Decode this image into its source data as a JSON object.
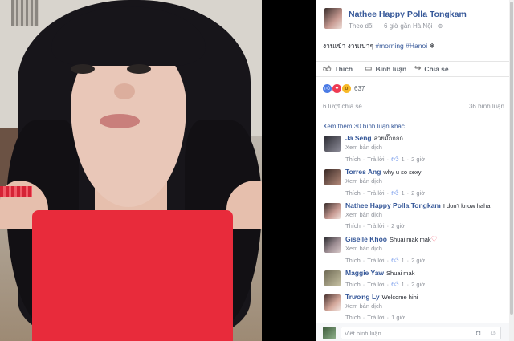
{
  "post": {
    "author": "Nathee Happy Polla Tongkam",
    "follow_label": "Theo dõi",
    "time_location": "6 giờ gần Hà Nội",
    "caption_plain": "งานเข้า งานเบาๆ",
    "hashtag_morning": "#morning",
    "hashtag_hanoi": "#Hanoi",
    "caption_emoji": "❄"
  },
  "actions": {
    "like": "Thích",
    "comment": "Bình luận",
    "share": "Chia sẻ"
  },
  "reactions": {
    "count": "637",
    "colors": {
      "like": "#4b7be5",
      "love": "#ee3b53",
      "wow": "#f7b928"
    }
  },
  "stats": {
    "shares": "6 lượt chia sẻ",
    "comments": "36 bình luận"
  },
  "more_comments": "Xem thêm 30 bình luận khác",
  "labels": {
    "translate": "Xem bản dịch",
    "reply": "Trả lời"
  },
  "comments": [
    {
      "author": "Ja Seng",
      "text": "สวยมั๊กกกก",
      "likes": "1",
      "time": "2 giờ"
    },
    {
      "author": "Torres Ang",
      "text": "why u so sexy",
      "likes": "1",
      "time": "2 giờ"
    },
    {
      "author": "Nathee Happy Polla Tongkam",
      "text": "I don't know haha",
      "likes": "",
      "time": "2 giờ"
    },
    {
      "author": "Giselle Khoo",
      "text": "Shuai mak mak",
      "likes": "1",
      "time": "2 giờ"
    },
    {
      "author": "Maggie Yaw",
      "text": "Shuai mak",
      "likes": "1",
      "time": "2 giờ"
    },
    {
      "author": "Trương Ly",
      "text": "Welcome hihi",
      "likes": "",
      "time": "1 giờ"
    }
  ],
  "reply_box": {
    "placeholder": "Viết bình luận..."
  },
  "icons": {
    "like": "thumbs-up-icon",
    "comment": "speech-bubble-icon",
    "share": "share-arrow-icon",
    "camera": "camera-icon",
    "sticker": "smiley-icon"
  },
  "colors": {
    "link": "#365899",
    "muted": "#90949c",
    "accent_red": "#e82b3b"
  }
}
